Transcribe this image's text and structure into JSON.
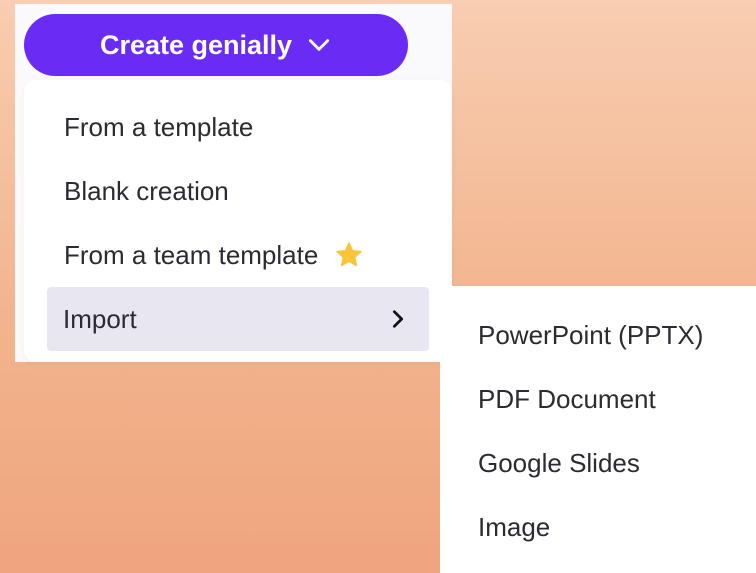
{
  "create_button": {
    "label": "Create genially",
    "icon": "chevron-down-icon",
    "bg_color": "#6a2cf5"
  },
  "menu": {
    "items": [
      {
        "label": "From a template"
      },
      {
        "label": "Blank creation"
      },
      {
        "label": "From a team template",
        "icon": "star-icon",
        "icon_color": "#f7c43a"
      },
      {
        "label": "Import",
        "icon": "chevron-right-icon",
        "active": true
      }
    ]
  },
  "submenu": {
    "items": [
      {
        "label": "PowerPoint (PPTX)"
      },
      {
        "label": "PDF Document"
      },
      {
        "label": "Google Slides"
      },
      {
        "label": "Image"
      }
    ]
  }
}
